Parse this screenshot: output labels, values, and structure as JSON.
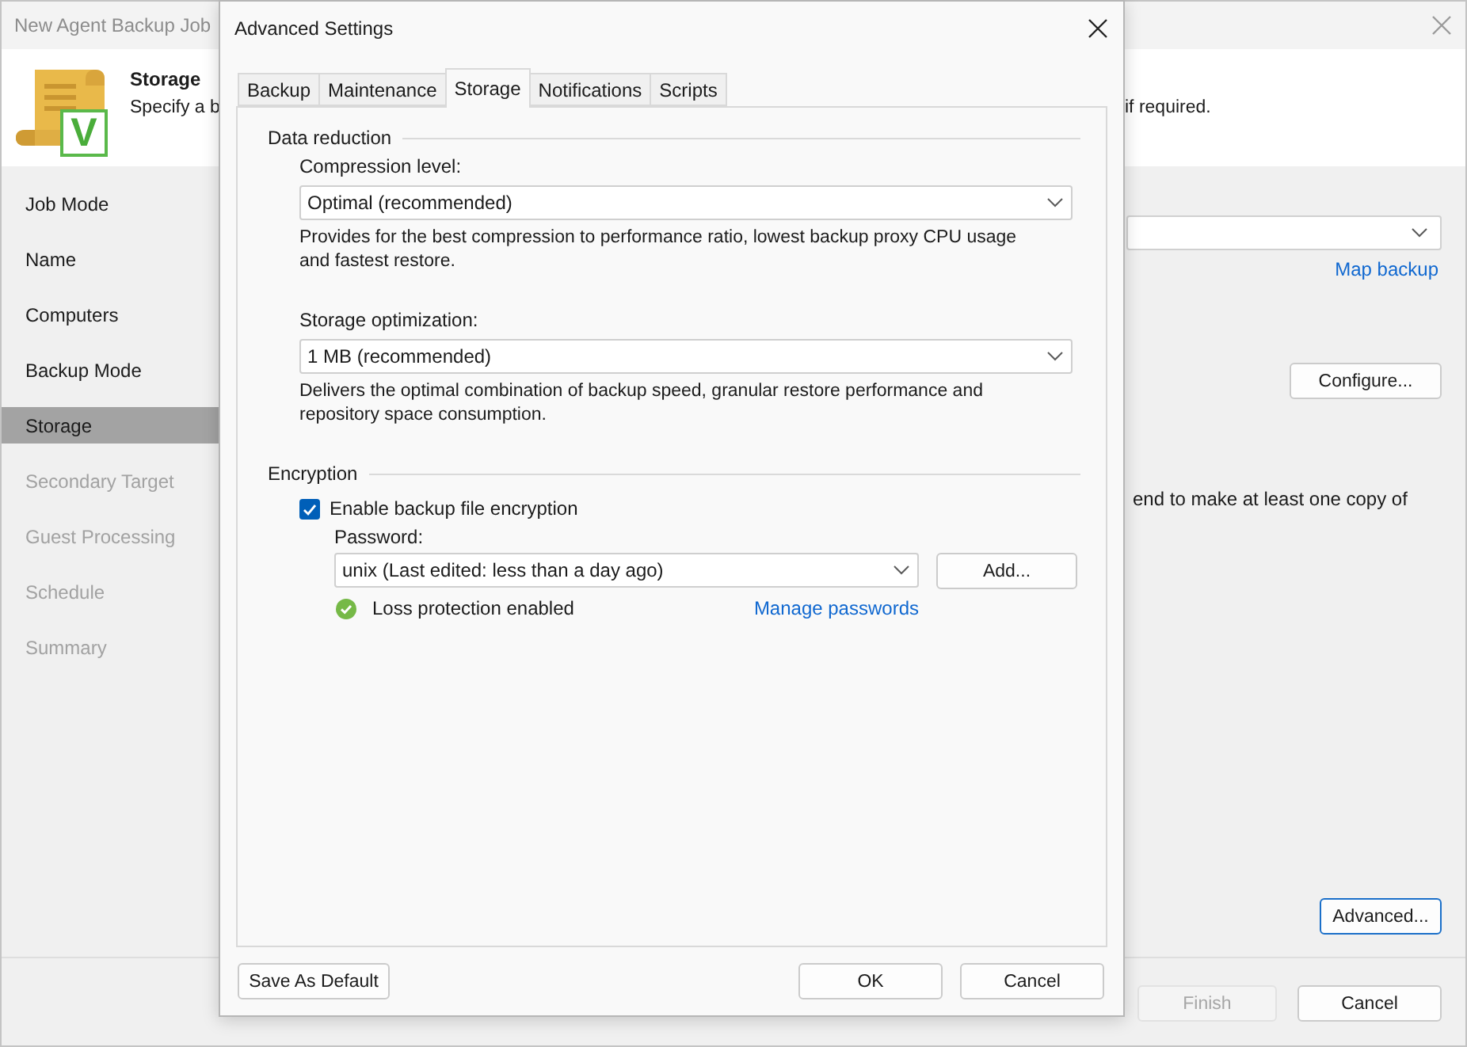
{
  "wizard": {
    "title": "New Agent Backup Job",
    "header": {
      "badge_letter": "V",
      "title": "Storage",
      "description": "Specify a b",
      "description_tail": "if required."
    },
    "steps": [
      {
        "label": "Job Mode",
        "selected": false,
        "disabled": false
      },
      {
        "label": "Name",
        "selected": false,
        "disabled": false
      },
      {
        "label": "Computers",
        "selected": false,
        "disabled": false
      },
      {
        "label": "Backup Mode",
        "selected": false,
        "disabled": false
      },
      {
        "label": "Storage",
        "selected": true,
        "disabled": false
      },
      {
        "label": "Secondary Target",
        "selected": false,
        "disabled": true
      },
      {
        "label": "Guest Processing",
        "selected": false,
        "disabled": true
      },
      {
        "label": "Schedule",
        "selected": false,
        "disabled": true
      },
      {
        "label": "Summary",
        "selected": false,
        "disabled": true
      }
    ],
    "map_link": "Map backup",
    "configure_button": "Configure...",
    "note": "end to make at least one copy of",
    "advanced_button": {
      "label": "Advanced...",
      "focused": true
    },
    "buttons": [
      {
        "label": "Finish",
        "disabled": true
      },
      {
        "label": "Cancel",
        "disabled": false
      }
    ]
  },
  "dialog": {
    "title": "Advanced Settings",
    "tabs": [
      {
        "label": "Backup",
        "selected": false
      },
      {
        "label": "Maintenance",
        "selected": false
      },
      {
        "label": "Storage",
        "selected": true
      },
      {
        "label": "Notifications",
        "selected": false
      },
      {
        "label": "Scripts",
        "selected": false
      }
    ],
    "data_reduction": {
      "heading": "Data reduction",
      "settings": [
        {
          "label": "Compression level:",
          "value": "Optimal (recommended)",
          "description": "Provides for the best compression to performance ratio, lowest backup proxy CPU usage and fastest restore."
        },
        {
          "label": "Storage optimization:",
          "value": "1 MB (recommended)",
          "description": "Delivers the optimal combination of backup speed, granular restore performance and repository space consumption."
        }
      ]
    },
    "encryption": {
      "heading": "Encryption",
      "enable": {
        "label": "Enable backup file encryption",
        "checked": true
      },
      "password": {
        "label": "Password:",
        "value": "unix (Last edited: less than a day ago)"
      },
      "add_button": "Add...",
      "status": "Loss protection enabled",
      "manage_link": "Manage passwords"
    },
    "default_button": "Save As Default",
    "buttons": [
      "OK",
      "Cancel"
    ]
  }
}
